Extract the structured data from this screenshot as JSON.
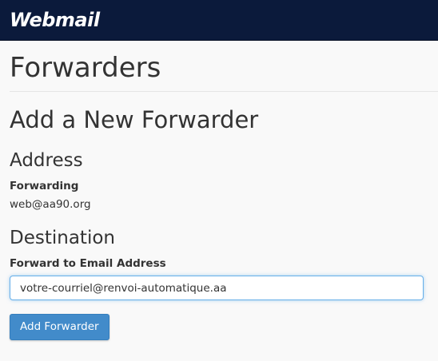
{
  "header": {
    "logo_text": "Webmail",
    "background_color": "#0b1a3b"
  },
  "page": {
    "title": "Forwarders",
    "section_title": "Add a New Forwarder"
  },
  "address": {
    "heading": "Address",
    "label": "Forwarding",
    "value": "web@aa90.org"
  },
  "destination": {
    "heading": "Destination",
    "label": "Forward to Email Address",
    "input_value": "votre-courriel@renvoi-automatique.aa"
  },
  "actions": {
    "add_label": "Add Forwarder",
    "button_color": "#428bca"
  }
}
